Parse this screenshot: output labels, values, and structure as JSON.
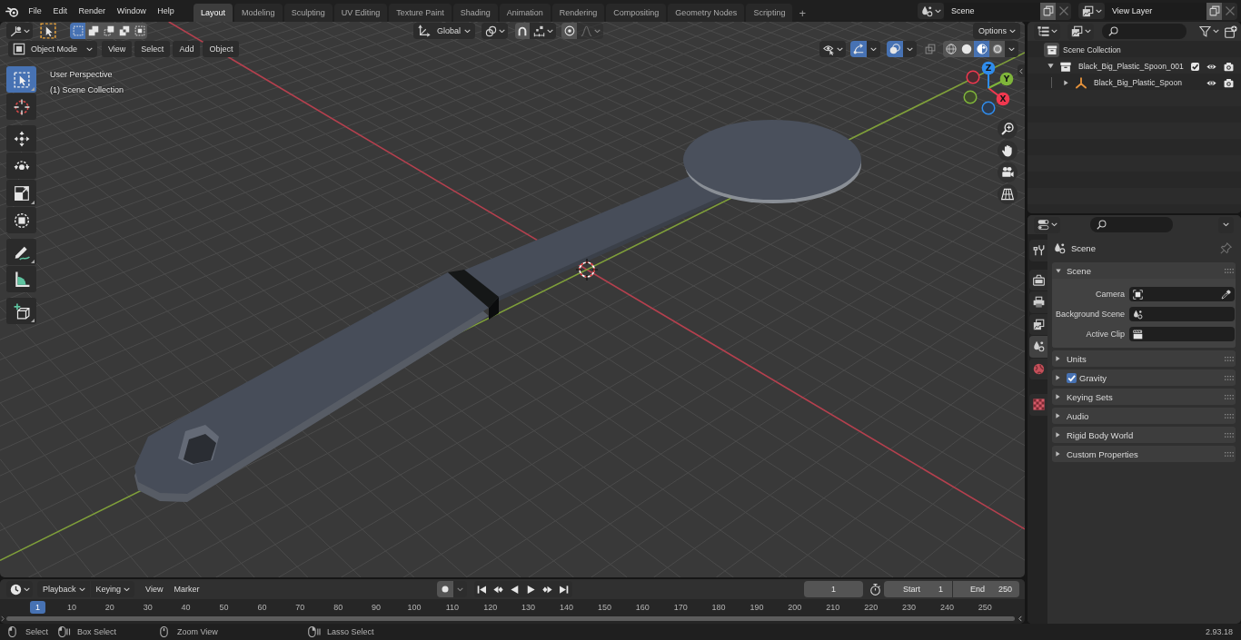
{
  "topbar": {
    "menus": [
      "File",
      "Edit",
      "Render",
      "Window",
      "Help"
    ],
    "workspaces": [
      {
        "label": "Layout",
        "selected": true
      },
      {
        "label": "Modeling",
        "selected": false
      },
      {
        "label": "Sculpting",
        "selected": false
      },
      {
        "label": "UV Editing",
        "selected": false
      },
      {
        "label": "Texture Paint",
        "selected": false
      },
      {
        "label": "Shading",
        "selected": false
      },
      {
        "label": "Animation",
        "selected": false
      },
      {
        "label": "Rendering",
        "selected": false
      },
      {
        "label": "Compositing",
        "selected": false
      },
      {
        "label": "Geometry Nodes",
        "selected": false
      },
      {
        "label": "Scripting",
        "selected": false
      }
    ],
    "add_workspace": "+",
    "scene": "Scene",
    "view_layer": "View Layer"
  },
  "viewport": {
    "tool_header": {
      "select_modes": [
        {
          "selected": true
        },
        {
          "selected": false
        },
        {
          "selected": false
        },
        {
          "selected": false
        },
        {
          "selected": false
        }
      ],
      "orientation": "Global",
      "options": "Options"
    },
    "header": {
      "mode": "Object Mode",
      "menus": [
        "View",
        "Select",
        "Add",
        "Object"
      ],
      "show_gizmos": true,
      "show_overlays": true,
      "xray": false,
      "shading": [
        {
          "selected": false
        },
        {
          "selected": false
        },
        {
          "selected": true
        },
        {
          "selected": false
        }
      ]
    },
    "toolbar": [
      {
        "selected": true
      },
      {
        "selected": false
      },
      {
        "selected": false
      },
      {
        "selected": false
      },
      {
        "selected": false
      },
      {
        "selected": false
      },
      {
        "selected": false
      },
      {
        "selected": false
      },
      {
        "selected": false
      }
    ],
    "info": [
      "User Perspective",
      "(1) Scene Collection"
    ],
    "gizmo_axes": [
      "X",
      "Y",
      "Z"
    ]
  },
  "timeline": {
    "menus": [
      {
        "kind": "dropdown",
        "label": "Playback"
      },
      {
        "kind": "dropdown",
        "label": "Keying"
      },
      {
        "kind": "menu",
        "label": "View"
      },
      {
        "kind": "menu",
        "label": "Marker"
      }
    ],
    "current_frame": "1",
    "start": {
      "label": "Start",
      "value": "1"
    },
    "end": {
      "label": "End",
      "value": "250"
    },
    "playhead": "1",
    "ruler": [
      "10",
      "20",
      "30",
      "40",
      "50",
      "60",
      "70",
      "80",
      "90",
      "100",
      "110",
      "120",
      "130",
      "140",
      "150",
      "160",
      "170",
      "180",
      "190",
      "200",
      "210",
      "220",
      "230",
      "240",
      "250"
    ]
  },
  "outliner": {
    "root": "Scene Collection",
    "items": [
      {
        "kind": "collection",
        "label": "Black_Big_Plastic_Spoon_001",
        "expanded": true,
        "checked": true,
        "children": [
          {
            "kind": "empty",
            "label": "Black_Big_Plastic_Spoon",
            "expanded": false
          }
        ]
      }
    ]
  },
  "properties": {
    "tabs": [
      {
        "selected": false
      },
      {
        "selected": false
      },
      {
        "selected": false
      },
      {
        "selected": false
      },
      {
        "selected": true
      },
      {
        "selected": false
      },
      {
        "selected": false
      }
    ],
    "context": "Scene",
    "panels": [
      {
        "kind": "fields",
        "title": "Scene",
        "expanded": true,
        "fields": [
          {
            "kind": "object",
            "label": "Camera"
          },
          {
            "kind": "scene",
            "label": "Background Scene"
          },
          {
            "kind": "clip",
            "label": "Active Clip"
          }
        ]
      },
      {
        "kind": "plain",
        "title": "Units",
        "expanded": false
      },
      {
        "kind": "toggle",
        "title": "Gravity",
        "expanded": false,
        "checked": true
      },
      {
        "kind": "plain",
        "title": "Keying Sets",
        "expanded": false
      },
      {
        "kind": "plain",
        "title": "Audio",
        "expanded": false
      },
      {
        "kind": "plain",
        "title": "Rigid Body World",
        "expanded": false
      },
      {
        "kind": "plain",
        "title": "Custom Properties",
        "expanded": false
      }
    ]
  },
  "status_bar": {
    "hints": [
      "Select",
      "Box Select",
      "Zoom View",
      "Lasso Select"
    ],
    "version": "2.93.18"
  }
}
